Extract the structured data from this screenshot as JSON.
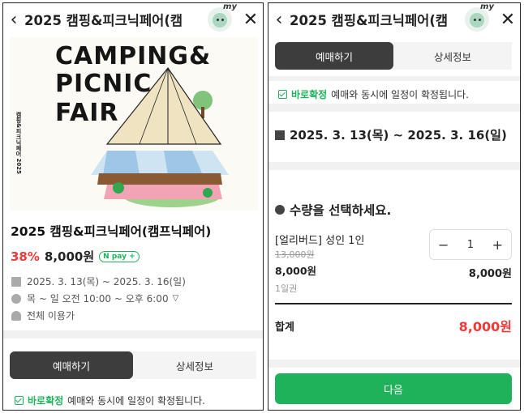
{
  "left": {
    "title": "2025 캠핑&피크닉페어(캠",
    "avatar_badge": "my",
    "poster": {
      "line1": "CAMPING&",
      "line2": "PICNIC",
      "line3": "FAIR",
      "side_text": "캠핑&피크닉페어 2025"
    },
    "product_name": "2025 캠핑&피크닉페어(캠프닉페어)",
    "discount": "38%",
    "price": "8,000원",
    "pay_badge": "pay",
    "date_range": "2025. 3. 13(목) ~ 2025. 3. 16(일)",
    "hours": "목 ~ 일 오전 10:00 ~ 오후 6:00",
    "audience": "전체 이용가",
    "tab_book": "예매하기",
    "tab_detail": "상세정보",
    "confirm_green": "바로확정",
    "confirm_text": "예매와 동시에 일정이 확정됩니다."
  },
  "right": {
    "title": "2025 캠핑&피크닉페어(캠",
    "avatar_badge": "my",
    "tab_book": "예매하기",
    "tab_detail": "상세정보",
    "confirm_green": "바로확정",
    "confirm_text": "예매와 동시에 일정이 확정됩니다.",
    "date_range": "2025. 3. 13(목) ~ 2025. 3. 16(일)",
    "qty_title": "수량을 선택하세요.",
    "ticket_name": "[얼리버드] 성인 1인",
    "original_price": "13,000원",
    "sale_price": "8,000원",
    "unit": "1일권",
    "quantity": "1",
    "line_price": "8,000원",
    "total_label": "합계",
    "total_value": "8,000원",
    "next_button": "다음"
  },
  "colors": {
    "accent_green": "#1fb25a",
    "discount_red": "#ef3a3a",
    "tab_dark": "#3d3d3d"
  }
}
